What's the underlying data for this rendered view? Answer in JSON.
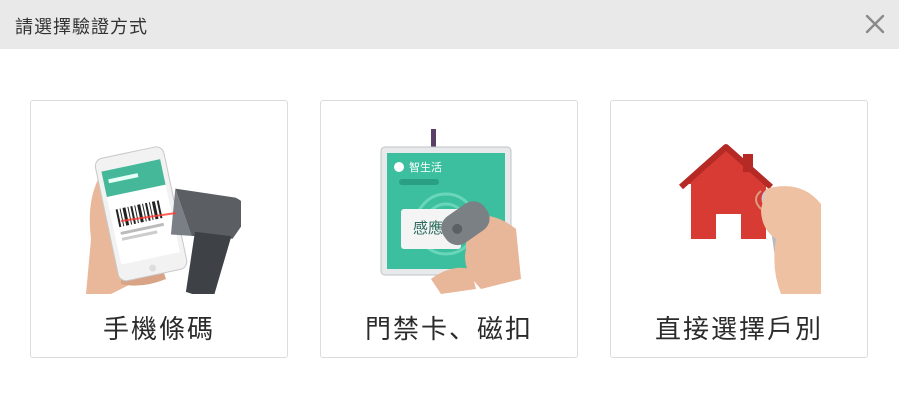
{
  "dialog": {
    "title": "請選擇驗證方式",
    "close_icon": "close-icon"
  },
  "options": [
    {
      "label": "手機條碼",
      "icon": "phone-barcode-scanner-illustration"
    },
    {
      "label": "門禁卡、磁扣",
      "icon": "access-card-keyfob-illustration"
    },
    {
      "label": "直接選擇戶別",
      "icon": "house-keychain-illustration"
    }
  ],
  "card_brand_text": "智生活",
  "card_big_text": "感應區",
  "colors": {
    "header_bg": "#e9e9e9",
    "card_border": "#dcdcdc",
    "card_teal": "#3bbf9f",
    "house_red": "#d83a34"
  }
}
